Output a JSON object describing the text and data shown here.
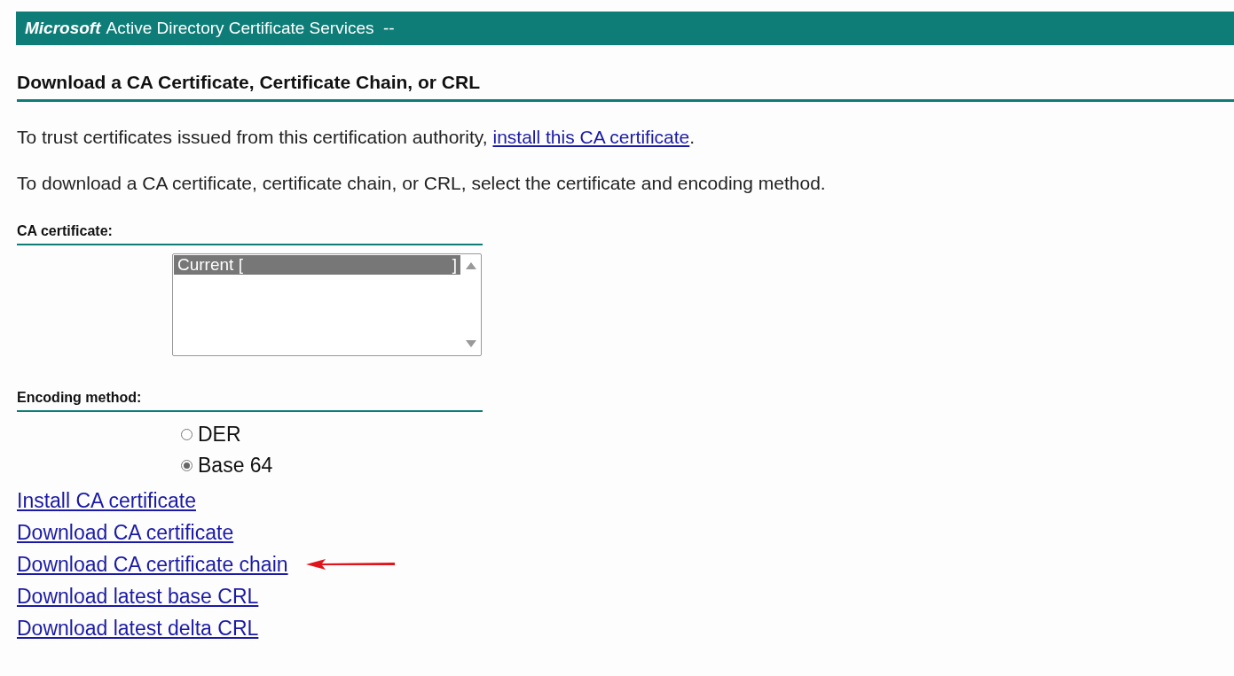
{
  "header": {
    "brand": "Microsoft",
    "title": "Active Directory Certificate Services  --"
  },
  "heading": "Download a CA Certificate, Certificate Chain, or CRL",
  "intro": {
    "before": "To trust certificates issued from this certification authority, ",
    "link": "install this CA certificate",
    "after": "."
  },
  "instruction": "To download a CA certificate, certificate chain, or CRL, select the certificate and encoding method.",
  "ca_certificate": {
    "label": "CA certificate:",
    "options": [
      {
        "label": "Current [",
        "suffix": "]",
        "selected": true
      }
    ]
  },
  "encoding": {
    "label": "Encoding method:",
    "options": [
      {
        "label": "DER",
        "selected": false
      },
      {
        "label": "Base 64",
        "selected": true
      }
    ]
  },
  "links": [
    {
      "label": "Install CA certificate",
      "highlighted": false
    },
    {
      "label": "Download CA certificate",
      "highlighted": false
    },
    {
      "label": "Download CA certificate chain",
      "highlighted": true
    },
    {
      "label": "Download latest base CRL",
      "highlighted": false
    },
    {
      "label": "Download latest delta CRL",
      "highlighted": false
    }
  ]
}
